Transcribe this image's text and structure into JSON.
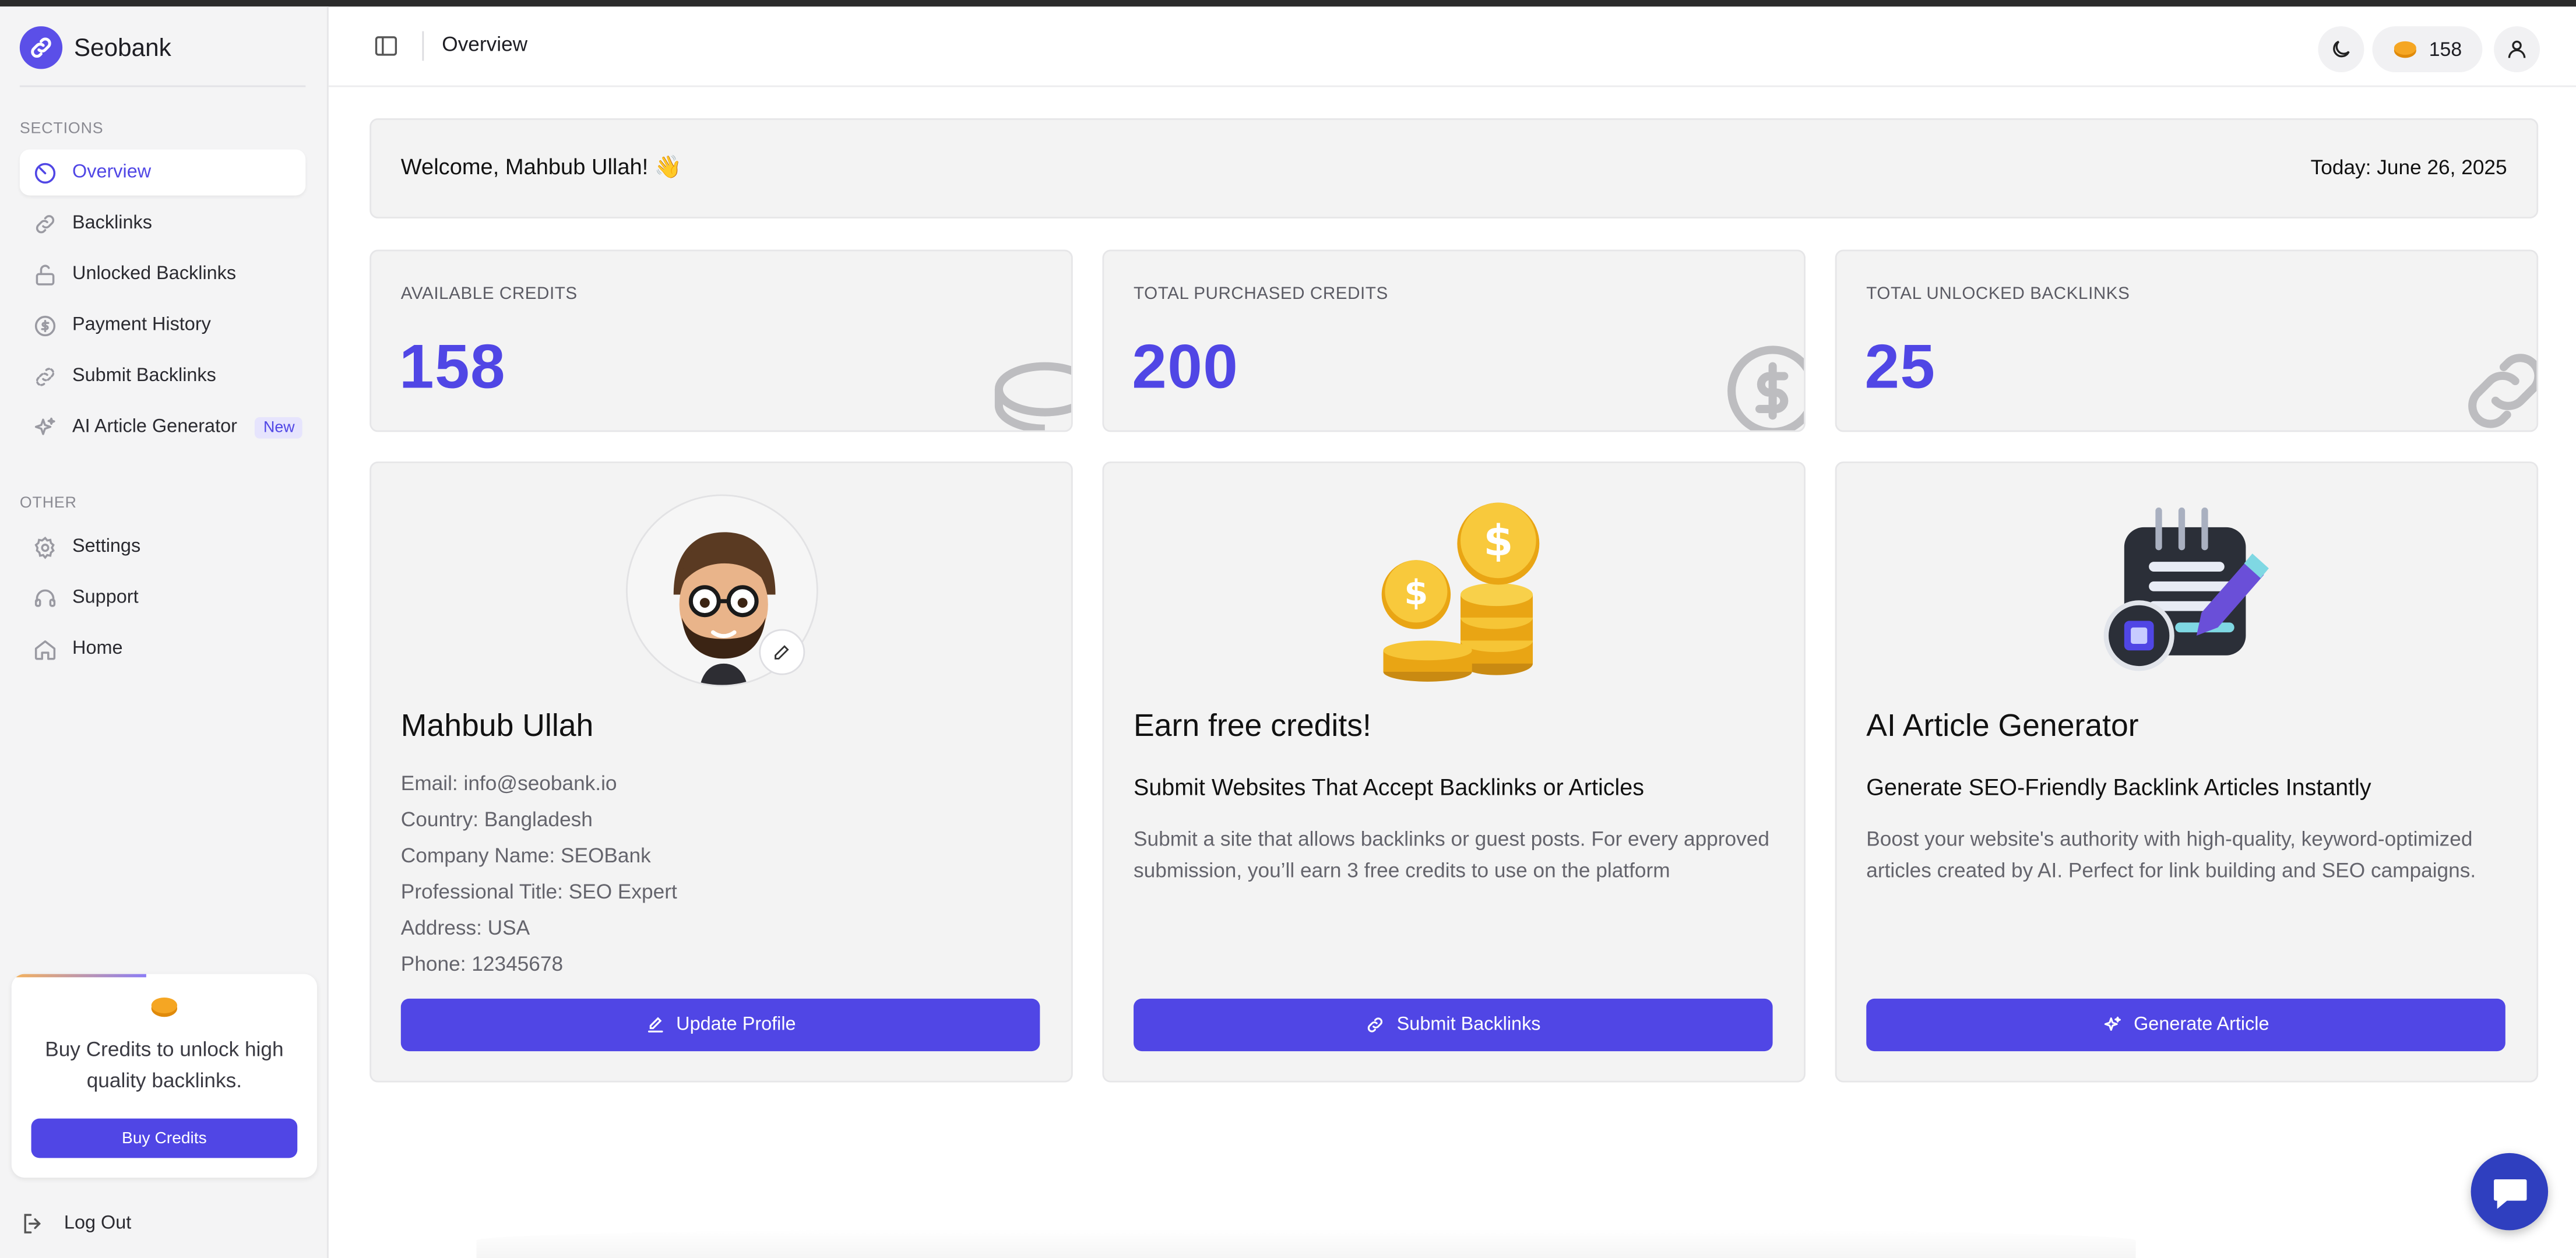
{
  "app": {
    "name": "Seobank",
    "accent_color": "#5046e5"
  },
  "sidebar": {
    "sections_label": "SECTIONS",
    "items": [
      {
        "label": "Overview",
        "icon": "gauge-icon",
        "active": true
      },
      {
        "label": "Backlinks",
        "icon": "link-icon"
      },
      {
        "label": "Unlocked Backlinks",
        "icon": "unlock-icon"
      },
      {
        "label": "Payment History",
        "icon": "dollar-circle-icon"
      },
      {
        "label": "Submit Backlinks",
        "icon": "link-submit-icon"
      },
      {
        "label": "AI Article Generator",
        "icon": "sparkles-icon",
        "badge": "New"
      }
    ],
    "other_label": "OTHER",
    "other_items": [
      {
        "label": "Settings",
        "icon": "gear-icon"
      },
      {
        "label": "Support",
        "icon": "headset-icon"
      },
      {
        "label": "Home",
        "icon": "home-icon"
      }
    ],
    "promo": {
      "text": "Buy Credits to unlock high quality backlinks.",
      "button": "Buy Credits"
    },
    "logout": "Log Out"
  },
  "header": {
    "title": "Overview",
    "credits": "158"
  },
  "welcome": {
    "greeting": "Welcome, Mahbub Ullah! 👋",
    "today": "Today: June 26, 2025"
  },
  "stats": [
    {
      "label": "AVAILABLE CREDITS",
      "value": "158",
      "icon": "coin-icon"
    },
    {
      "label": "TOTAL PURCHASED CREDITS",
      "value": "200",
      "icon": "dollar-icon"
    },
    {
      "label": "TOTAL UNLOCKED BACKLINKS",
      "value": "25",
      "icon": "link-icon"
    }
  ],
  "profile": {
    "name": "Mahbub Ullah",
    "lines": [
      "Email: info@seobank.io",
      "Country: Bangladesh",
      "Company Name: SEOBank",
      "Professional Title: SEO Expert",
      "Address: USA",
      "Phone: 12345678"
    ],
    "button": "Update Profile"
  },
  "earn": {
    "title": "Earn free credits!",
    "subtitle": "Submit Websites That Accept Backlinks or Articles",
    "description": "Submit a site that allows backlinks or guest posts. For every approved submission, you’ll earn 3 free credits to use on the platform",
    "button": "Submit Backlinks"
  },
  "ai": {
    "title": "AI Article Generator",
    "subtitle": "Generate SEO-Friendly Backlink Articles Instantly",
    "description": "Boost your website's authority with high-quality, keyword-optimized articles created by AI. Perfect for link building and SEO campaigns.",
    "button": "Generate Article"
  }
}
